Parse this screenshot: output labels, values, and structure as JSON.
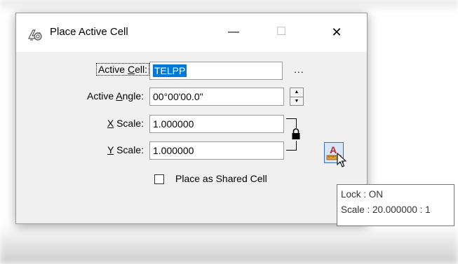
{
  "window": {
    "title": "Place Active Cell",
    "minimize": "—",
    "maximize": "☐",
    "close": "✕"
  },
  "fields": {
    "active_cell": {
      "label_pre": "Active ",
      "label_u": "C",
      "label_post": "ell:",
      "value": "TELPP"
    },
    "active_angle": {
      "label_pre": "Active ",
      "label_u": "A",
      "label_post": "ngle:",
      "value": "00°00'00.0\""
    },
    "x_scale": {
      "label_pre": "",
      "label_u": "X",
      "label_post": " Scale:",
      "value": "1.000000"
    },
    "y_scale": {
      "label_pre": "",
      "label_u": "Y",
      "label_post": " Scale:",
      "value": "1.000000"
    }
  },
  "browse_label": "...",
  "spin": {
    "up": "▲",
    "down": "▼"
  },
  "shared_cell": {
    "label": "Place as Shared Cell",
    "checked": false
  },
  "acs_button": {
    "glyph": "A",
    "icon": "annotation-scale-icon"
  },
  "tooltip": {
    "line1": "Lock : ON",
    "line2": "Scale : 20.000000 : 1"
  },
  "colors": {
    "selection": "#0078d7",
    "acs_letter": "#c0282d",
    "acs_bg": "#d6e6f7"
  }
}
